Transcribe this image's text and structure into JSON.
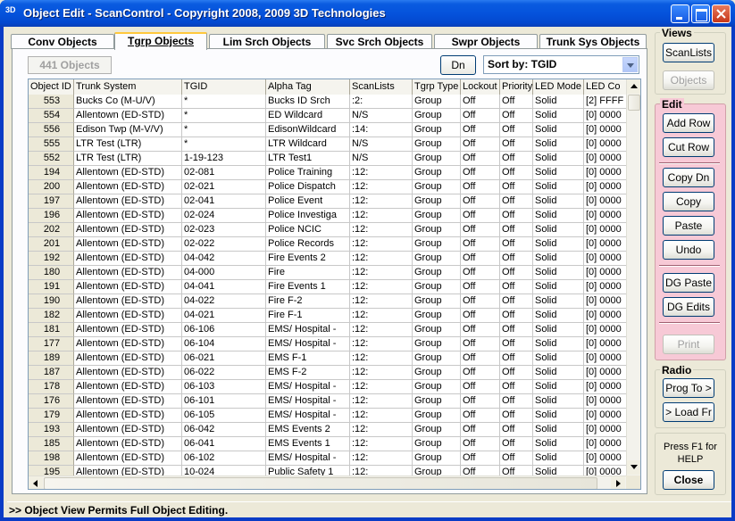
{
  "window": {
    "title": "Object Edit - ScanControl - Copyright 2008, 2009 3D Technologies",
    "icon": "3D"
  },
  "tabs": [
    {
      "label": "Conv Objects",
      "active": false
    },
    {
      "label": "Tgrp Objects",
      "active": true
    },
    {
      "label": "Lim Srch Objects",
      "active": false
    },
    {
      "label": "Svc Srch Objects",
      "active": false
    },
    {
      "label": "Swpr Objects",
      "active": false
    },
    {
      "label": "Trunk Sys Objects",
      "active": false
    }
  ],
  "toolbar": {
    "count": "441 Objects",
    "dn_label": "Dn",
    "sort_label": "Sort by: TGID"
  },
  "grid": {
    "columns": [
      "Object ID",
      "Trunk System",
      "TGID",
      "Alpha Tag",
      "ScanLists",
      "Tgrp Type",
      "Lockout",
      "Priority",
      "LED Mode",
      "LED Co"
    ],
    "rows": [
      [
        "553",
        "Bucks Co (M-U/V)",
        "*",
        "Bucks ID Srch",
        ":2:",
        "Group",
        "Off",
        "Off",
        "Solid",
        "[2] FFFF"
      ],
      [
        "554",
        "Allentown (ED-STD)",
        "*",
        "ED Wildcard",
        "N/S",
        "Group",
        "Off",
        "Off",
        "Solid",
        "[0] 0000"
      ],
      [
        "556",
        "Edison Twp (M-V/V)",
        "*",
        "EdisonWildcard",
        ":14:",
        "Group",
        "Off",
        "Off",
        "Solid",
        "[0] 0000"
      ],
      [
        "555",
        "LTR Test (LTR)",
        "*",
        "LTR Wildcard",
        "N/S",
        "Group",
        "Off",
        "Off",
        "Solid",
        "[0] 0000"
      ],
      [
        "552",
        "LTR Test (LTR)",
        "1-19-123",
        "LTR Test1",
        "N/S",
        "Group",
        "Off",
        "Off",
        "Solid",
        "[0] 0000"
      ],
      [
        "194",
        "Allentown (ED-STD)",
        "02-081",
        "Police Training",
        ":12:",
        "Group",
        "Off",
        "Off",
        "Solid",
        "[0] 0000"
      ],
      [
        "200",
        "Allentown (ED-STD)",
        "02-021",
        "Police Dispatch",
        ":12:",
        "Group",
        "Off",
        "Off",
        "Solid",
        "[0] 0000"
      ],
      [
        "197",
        "Allentown (ED-STD)",
        "02-041",
        "Police Event",
        ":12:",
        "Group",
        "Off",
        "Off",
        "Solid",
        "[0] 0000"
      ],
      [
        "196",
        "Allentown (ED-STD)",
        "02-024",
        "Police Investiga",
        ":12:",
        "Group",
        "Off",
        "Off",
        "Solid",
        "[0] 0000"
      ],
      [
        "202",
        "Allentown (ED-STD)",
        "02-023",
        "Police NCIC",
        ":12:",
        "Group",
        "Off",
        "Off",
        "Solid",
        "[0] 0000"
      ],
      [
        "201",
        "Allentown (ED-STD)",
        "02-022",
        "Police Records",
        ":12:",
        "Group",
        "Off",
        "Off",
        "Solid",
        "[0] 0000"
      ],
      [
        "192",
        "Allentown (ED-STD)",
        "04-042",
        "Fire Events 2",
        ":12:",
        "Group",
        "Off",
        "Off",
        "Solid",
        "[0] 0000"
      ],
      [
        "180",
        "Allentown (ED-STD)",
        "04-000",
        "Fire",
        ":12:",
        "Group",
        "Off",
        "Off",
        "Solid",
        "[0] 0000"
      ],
      [
        "191",
        "Allentown (ED-STD)",
        "04-041",
        "Fire Events 1",
        ":12:",
        "Group",
        "Off",
        "Off",
        "Solid",
        "[0] 0000"
      ],
      [
        "190",
        "Allentown (ED-STD)",
        "04-022",
        "Fire F-2",
        ":12:",
        "Group",
        "Off",
        "Off",
        "Solid",
        "[0] 0000"
      ],
      [
        "182",
        "Allentown (ED-STD)",
        "04-021",
        "Fire F-1",
        ":12:",
        "Group",
        "Off",
        "Off",
        "Solid",
        "[0] 0000"
      ],
      [
        "181",
        "Allentown (ED-STD)",
        "06-106",
        "EMS/ Hospital -",
        ":12:",
        "Group",
        "Off",
        "Off",
        "Solid",
        "[0] 0000"
      ],
      [
        "177",
        "Allentown (ED-STD)",
        "06-104",
        "EMS/ Hospital -",
        ":12:",
        "Group",
        "Off",
        "Off",
        "Solid",
        "[0] 0000"
      ],
      [
        "189",
        "Allentown (ED-STD)",
        "06-021",
        "EMS F-1",
        ":12:",
        "Group",
        "Off",
        "Off",
        "Solid",
        "[0] 0000"
      ],
      [
        "187",
        "Allentown (ED-STD)",
        "06-022",
        "EMS F-2",
        ":12:",
        "Group",
        "Off",
        "Off",
        "Solid",
        "[0] 0000"
      ],
      [
        "178",
        "Allentown (ED-STD)",
        "06-103",
        "EMS/ Hospital -",
        ":12:",
        "Group",
        "Off",
        "Off",
        "Solid",
        "[0] 0000"
      ],
      [
        "176",
        "Allentown (ED-STD)",
        "06-101",
        "EMS/ Hospital -",
        ":12:",
        "Group",
        "Off",
        "Off",
        "Solid",
        "[0] 0000"
      ],
      [
        "179",
        "Allentown (ED-STD)",
        "06-105",
        "EMS/ Hospital -",
        ":12:",
        "Group",
        "Off",
        "Off",
        "Solid",
        "[0] 0000"
      ],
      [
        "193",
        "Allentown (ED-STD)",
        "06-042",
        "EMS Events 2",
        ":12:",
        "Group",
        "Off",
        "Off",
        "Solid",
        "[0] 0000"
      ],
      [
        "185",
        "Allentown (ED-STD)",
        "06-041",
        "EMS Events 1",
        ":12:",
        "Group",
        "Off",
        "Off",
        "Solid",
        "[0] 0000"
      ],
      [
        "198",
        "Allentown (ED-STD)",
        "06-102",
        "EMS/ Hospital -",
        ":12:",
        "Group",
        "Off",
        "Off",
        "Solid",
        "[0] 0000"
      ],
      [
        "195",
        "Allentown (ED-STD)",
        "10-024",
        "Public Safety 1",
        ":12:",
        "Group",
        "Off",
        "Off",
        "Solid",
        "[0] 0000"
      ]
    ]
  },
  "side": {
    "views_label": "Views",
    "scanlists": "ScanLists",
    "objects": "Objects",
    "edit_label": "Edit",
    "add_row": "Add Row",
    "cut_row": "Cut Row",
    "copy_dn": "Copy Dn",
    "copy": "Copy",
    "paste": "Paste",
    "undo": "Undo",
    "dg_paste": "DG Paste",
    "dg_edits": "DG Edits",
    "print": "Print",
    "radio_label": "Radio",
    "prog_to": "Prog To >",
    "load_fr": "> Load Fr",
    "help_line1": "Press F1 for",
    "help_line2": "HELP",
    "close": "Close"
  },
  "status": ">> Object View Permits Full Object Editing."
}
